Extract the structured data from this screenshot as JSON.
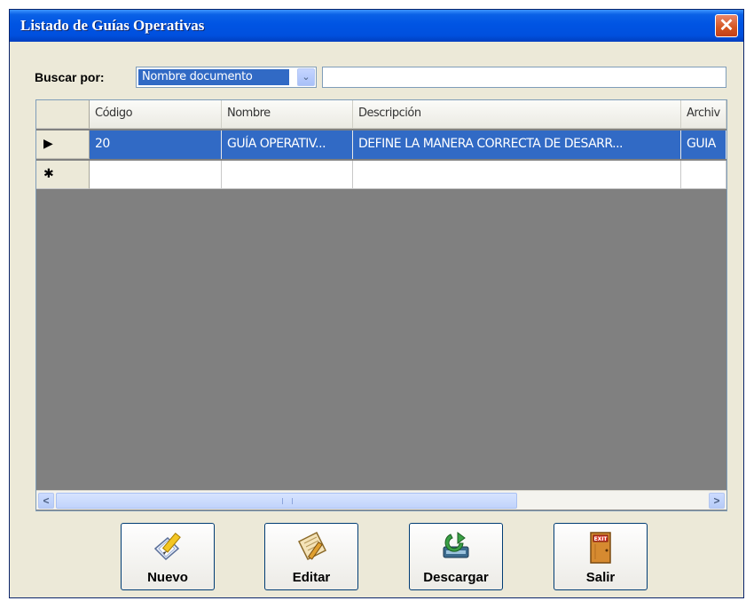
{
  "window": {
    "title": "Listado de Guías Operativas",
    "close_symbol": "✕"
  },
  "search": {
    "label": "Buscar por:",
    "field_value": "Nombre documento",
    "arrow": "⌄",
    "query": ""
  },
  "grid": {
    "columns": [
      "",
      "Código",
      "Nombre",
      "Descripción",
      "Archiv"
    ],
    "rows": [
      {
        "indicator": "▶",
        "cells": [
          "20",
          "GUÍA OPERATIV...",
          "DEFINE LA MANERA CORRECTA DE DESARR...",
          "GUIA "
        ]
      }
    ],
    "new_row_indicator": "✱"
  },
  "scrollbar": {
    "left": "<",
    "right": ">"
  },
  "buttons": {
    "nuevo": "Nuevo",
    "editar": "Editar",
    "descargar": "Descargar",
    "salir": "Salir",
    "exit_sign": "EXIT"
  },
  "colors": {
    "title_bar": "#0054e3",
    "selection": "#316ac5",
    "grid_background": "#808080",
    "window": "#ece9d8"
  }
}
